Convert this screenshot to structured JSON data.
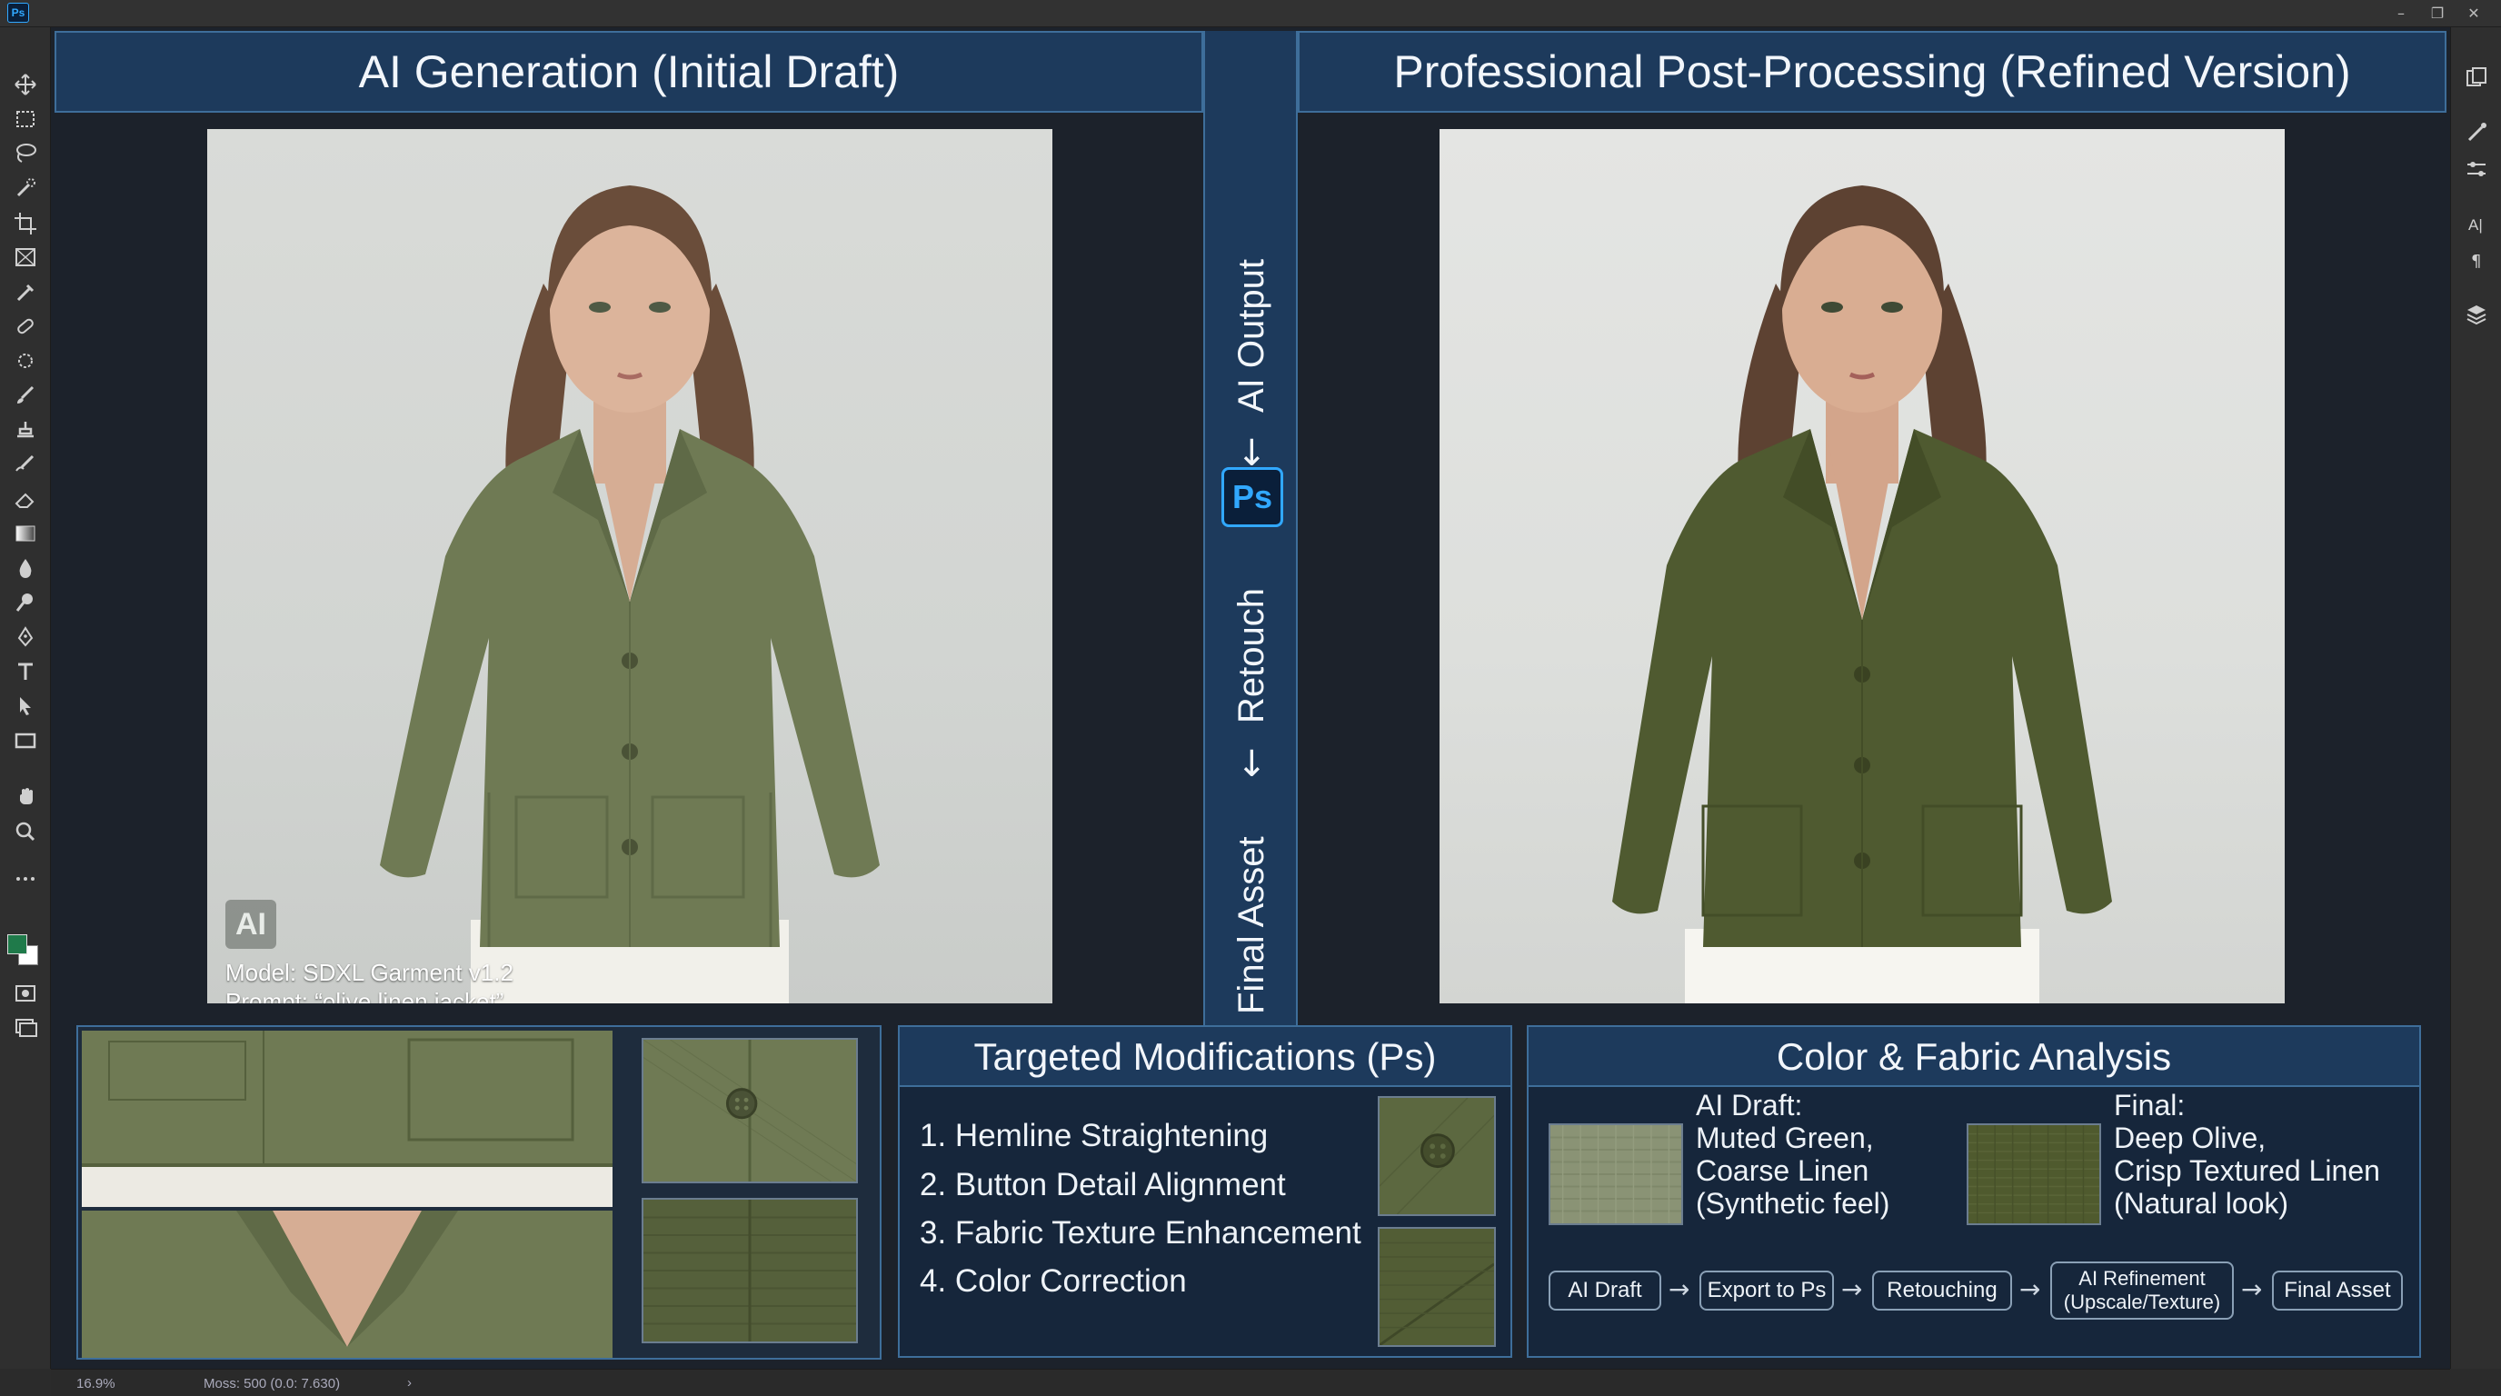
{
  "app": {
    "logo_text": "Ps",
    "window_controls": [
      "–",
      "❐",
      "✕"
    ]
  },
  "headers": {
    "left": "AI Generation (Initial Draft)",
    "right": "Professional Post-Processing (Refined Version)"
  },
  "workflow_spine": {
    "labels": [
      "AI Output",
      "Retouch",
      "Final Asset"
    ],
    "arrow": "←",
    "badge": "Ps"
  },
  "ai_draft_photo": {
    "badge": "AI",
    "model_line": "Model: SDXL Garment v1.2",
    "prompt_line": "Prompt: “olive linen jacket”"
  },
  "targeted_modifications": {
    "title": "Targeted Modifications (Ps)",
    "items": [
      "1. Hemline Straightening",
      "2. Button Detail Alignment",
      "3. Fabric Texture Enhancement",
      "4. Color Correction"
    ]
  },
  "color_fabric": {
    "title": "Color & Fabric Analysis",
    "draft_text": "AI Draft:\nMuted Green,\nCoarse Linen\n(Synthetic feel)",
    "final_text": "Final:\nDeep Olive,\nCrisp Textured Linen\n(Natural look)",
    "draft_color": "#8a9375",
    "final_color": "#4f5a2e",
    "flow": [
      "AI Draft",
      "Export to Ps",
      "Retouching",
      "AI Refinement\n(Upscale/Texture)",
      "Final Asset"
    ],
    "flow_arrow": "→"
  },
  "colors": {
    "accent": "#31a8ff",
    "panel_fill": "#1d3a5c",
    "panel_border": "#3e6e9a",
    "jacket_draft": "#6f7a54",
    "jacket_final": "#4f5a30",
    "foreground_swatch": "#1f7a4a",
    "background_swatch": "#ffffff"
  },
  "tools": [
    "move-tool-icon",
    "marquee-tool-icon",
    "lasso-tool-icon",
    "quick-select-icon",
    "crop-tool-icon",
    "frame-tool-icon",
    "eyedropper-icon",
    "healing-brush-icon",
    "spot-heal-icon",
    "brush-tool-icon",
    "clone-stamp-icon",
    "history-brush-icon",
    "eraser-icon",
    "gradient-tool-icon",
    "blur-tool-icon",
    "dodge-tool-icon",
    "pen-tool-icon",
    "type-tool-icon",
    "path-select-icon",
    "rectangle-tool-icon",
    "hand-tool-icon",
    "zoom-tool-icon",
    "more-tools-icon"
  ],
  "right_panel_icons": [
    "libraries-icon",
    "adjustments-icon",
    "properties-icon",
    "character-icon",
    "paragraph-icon",
    "layers-icon"
  ],
  "status_bar": {
    "zoom": "16.9%",
    "info": "Moss: 500 (0.0: 7.630)",
    "arrow": "›"
  }
}
